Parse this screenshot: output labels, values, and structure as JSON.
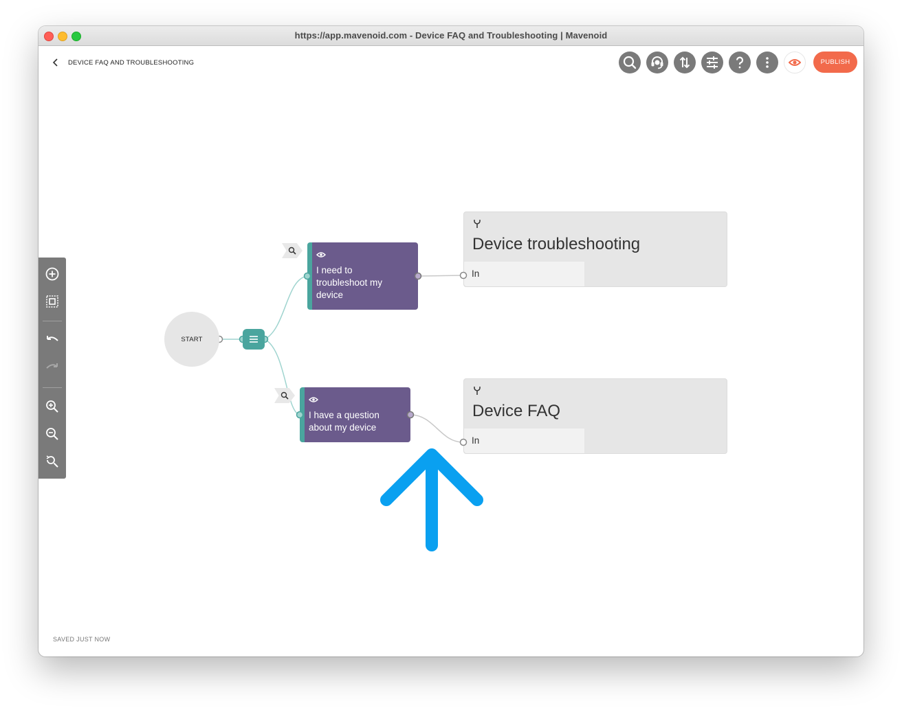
{
  "window": {
    "title": "https://app.mavenoid.com - Device FAQ and Troubleshooting | Mavenoid"
  },
  "header": {
    "flow_title": "DEVICE FAQ AND TROUBLESHOOTING",
    "toolbar": [
      {
        "name": "search-button",
        "icon": "search-icon"
      },
      {
        "name": "agent-button",
        "icon": "headset-icon"
      },
      {
        "name": "import-export-button",
        "icon": "sort-arrows-icon"
      },
      {
        "name": "settings-button",
        "icon": "sliders-icon"
      },
      {
        "name": "help-button",
        "icon": "question-mark-icon"
      },
      {
        "name": "more-button",
        "icon": "more-vertical-icon"
      }
    ],
    "preview_icon": "eye-icon",
    "publish_label": "PUBLISH"
  },
  "left_toolbar": {
    "buttons": [
      "add-node-icon",
      "select-area-icon",
      "undo-icon",
      "redo-icon",
      "zoom-in-icon",
      "zoom-out-icon",
      "zoom-reset-icon"
    ]
  },
  "canvas": {
    "start_label": "START",
    "question_nodes": [
      {
        "text": "I need to troubleshoot my device",
        "icon": "eye-icon"
      },
      {
        "text": "I have a question about my device",
        "icon": "eye-icon"
      }
    ],
    "flow_nodes": [
      {
        "title": "Device troubleshooting",
        "input_label": "In",
        "icon": "merge-icon"
      },
      {
        "title": "Device FAQ",
        "input_label": "In",
        "icon": "merge-icon"
      }
    ]
  },
  "footer": {
    "status": "SAVED JUST NOW"
  },
  "colors": {
    "accent": "#f26a4b",
    "question_node": "#6b5b8c",
    "teal": "#4aa59e",
    "arrow": "#0aa0f0"
  }
}
